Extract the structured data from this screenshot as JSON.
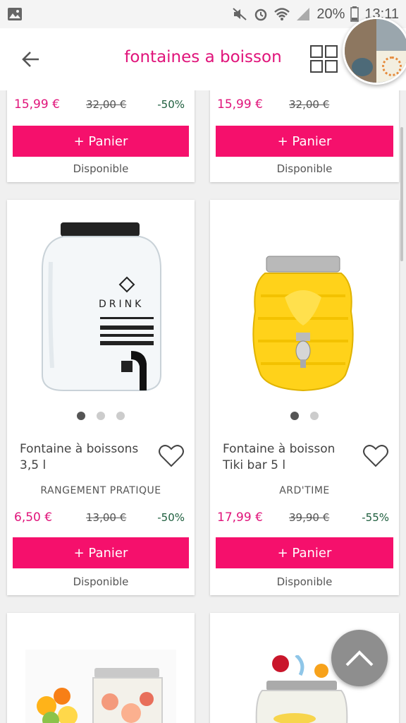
{
  "status_bar": {
    "battery": "20%",
    "time": "13:11"
  },
  "app_bar": {
    "title": "fontaines a boisson"
  },
  "top_products": [
    {
      "price": "15,99 €",
      "old_price": "32,00 €",
      "discount": "-50%",
      "button": "+ Panier",
      "availability": "Disponible"
    },
    {
      "price": "15,99 €",
      "old_price": "32,00 €",
      "button": "+ Panier",
      "availability": "Disponible"
    }
  ],
  "products": [
    {
      "name": "Fontaine à boissons 3,5 l",
      "brand": "RANGEMENT PRATIQUE",
      "price": "6,50 €",
      "old_price": "13,00 €",
      "discount": "-50%",
      "button": "+ Panier",
      "availability": "Disponible",
      "image_label": "DRINK",
      "image_count": 3,
      "active_image": 1
    },
    {
      "name": "Fontaine à boisson Tiki bar 5 l",
      "brand": "ARD'TIME",
      "price": "17,99 €",
      "old_price": "39,90 €",
      "discount": "-55%",
      "button": "+ Panier",
      "availability": "Disponible",
      "image_count": 2,
      "active_image": 1
    }
  ],
  "colors": {
    "accent": "#e0137a",
    "button": "#f5106c",
    "discount": "#1d5e3d"
  }
}
